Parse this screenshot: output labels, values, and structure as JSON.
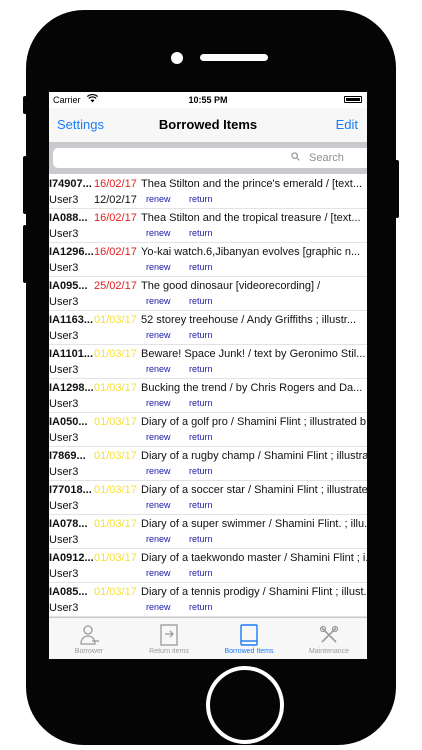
{
  "status_bar": {
    "carrier": "Carrier",
    "wifi_icon": "wifi-icon",
    "time": "10:55 PM",
    "battery_icon": "battery-icon"
  },
  "nav": {
    "left_button": "Settings",
    "title": "Borrowed Items",
    "right_button": "Edit"
  },
  "search": {
    "placeholder": "Search",
    "icon": "search-icon"
  },
  "colors": {
    "accent": "#1a7cf6",
    "overdue": "#e02020",
    "due_soon": "#f5e03a",
    "link": "#1a1aa8"
  },
  "item_actions": {
    "renew": "renew",
    "return": "return"
  },
  "items": [
    {
      "id": "I74907...",
      "due": "16/02/17",
      "due_status": "overdue",
      "title": "Thea Stilton and the prince's emerald / [text...",
      "user": "User3",
      "date2": "12/02/17"
    },
    {
      "id": "IA088...",
      "due": "16/02/17",
      "due_status": "overdue",
      "title": "Thea Stilton and the tropical treasure / [text...",
      "user": "User3",
      "date2": ""
    },
    {
      "id": "IA1296...",
      "due": "16/02/17",
      "due_status": "overdue",
      "title": "Yo-kai watch.6,Jibanyan evolves [graphic n...",
      "user": "User3",
      "date2": ""
    },
    {
      "id": "IA095...",
      "due": "25/02/17",
      "due_status": "overdue",
      "title": "The good dinosaur [videorecording] /",
      "user": "User3",
      "date2": ""
    },
    {
      "id": "IA1163...",
      "due": "01/03/17",
      "due_status": "soon",
      "title": "52 storey treehouse / Andy Griffiths ; illustr...",
      "user": "User3",
      "date2": ""
    },
    {
      "id": "IA1101...",
      "due": "01/03/17",
      "due_status": "soon",
      "title": "Beware! Space Junk! / text by Geronimo Stil...",
      "user": "User3",
      "date2": ""
    },
    {
      "id": "IA1298...",
      "due": "01/03/17",
      "due_status": "soon",
      "title": "Bucking the trend / by Chris Rogers and Da...",
      "user": "User3",
      "date2": ""
    },
    {
      "id": "IA050...",
      "due": "01/03/17",
      "due_status": "soon",
      "title": "Diary of a golf pro / Shamini Flint ; illustrated b...",
      "user": "User3",
      "date2": ""
    },
    {
      "id": "I7869...",
      "due": "01/03/17",
      "due_status": "soon",
      "title": "Diary of a rugby champ / Shamini Flint ; illustra...",
      "user": "User3",
      "date2": ""
    },
    {
      "id": "I77018...",
      "due": "01/03/17",
      "due_status": "soon",
      "title": "Diary of a soccer star / Shamini Flint ; illustrate...",
      "user": "User3",
      "date2": ""
    },
    {
      "id": "IA078...",
      "due": "01/03/17",
      "due_status": "soon",
      "title": "Diary of a super swimmer / Shamini Flint. ; illu...",
      "user": "User3",
      "date2": ""
    },
    {
      "id": "IA0912...",
      "due": "01/03/17",
      "due_status": "soon",
      "title": "Diary of a taekwondo master / Shamini Flint ; i...",
      "user": "User3",
      "date2": ""
    },
    {
      "id": "IA085...",
      "due": "01/03/17",
      "due_status": "soon",
      "title": "Diary of a tennis prodigy / Shamini Flint ; illust...",
      "user": "User3",
      "date2": ""
    }
  ],
  "tabs": [
    {
      "label": "Borrower",
      "icon": "borrower-icon",
      "active": false
    },
    {
      "label": "Return items",
      "icon": "return-items-icon",
      "active": false
    },
    {
      "label": "Borrowed Items",
      "icon": "book-icon",
      "active": true
    },
    {
      "label": "Maintenance",
      "icon": "tools-icon",
      "active": false
    }
  ]
}
